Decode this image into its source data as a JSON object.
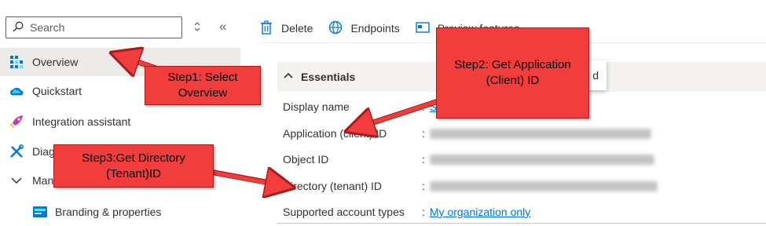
{
  "search": {
    "placeholder": "Search"
  },
  "sidebar": {
    "updown_glyph": "◇",
    "collapse_glyph": "«",
    "items": [
      {
        "label": "Overview",
        "icon": "overview-grid-icon"
      },
      {
        "label": "Quickstart",
        "icon": "cloud-icon"
      },
      {
        "label": "Integration assistant",
        "icon": "rocket-icon"
      },
      {
        "label": "Diag",
        "icon": "tools-icon"
      },
      {
        "label": "Mana",
        "icon": "chevron-down-icon"
      },
      {
        "label": "Branding & properties",
        "icon": "branding-icon"
      }
    ]
  },
  "toolbar": {
    "delete_label": "Delete",
    "endpoints_label": "Endpoints",
    "preview_label": "Preview features"
  },
  "essentials": {
    "title": "Essentials",
    "tooltip_text": "d",
    "rows": [
      {
        "key": "Display name",
        "value": "S"
      },
      {
        "key": "Application (client) ID",
        "value": ""
      },
      {
        "key": "Object ID",
        "value": ""
      },
      {
        "key": "Directory (tenant) ID",
        "value": ""
      },
      {
        "key": "Supported account types",
        "value": "My organization only"
      }
    ],
    "colon": ":"
  },
  "callouts": {
    "step1": [
      "Step1: Select",
      "Overview"
    ],
    "step2": [
      "Step2: Get Application",
      "(Client) ID"
    ],
    "step3": [
      "Step3:Get Directory",
      "(Tenant)ID"
    ]
  },
  "colors": {
    "callout_fill": "#f23d3d",
    "link": "#0078d4",
    "selected_bg": "#edebe9",
    "essentials_bg": "#f3f2f1"
  }
}
